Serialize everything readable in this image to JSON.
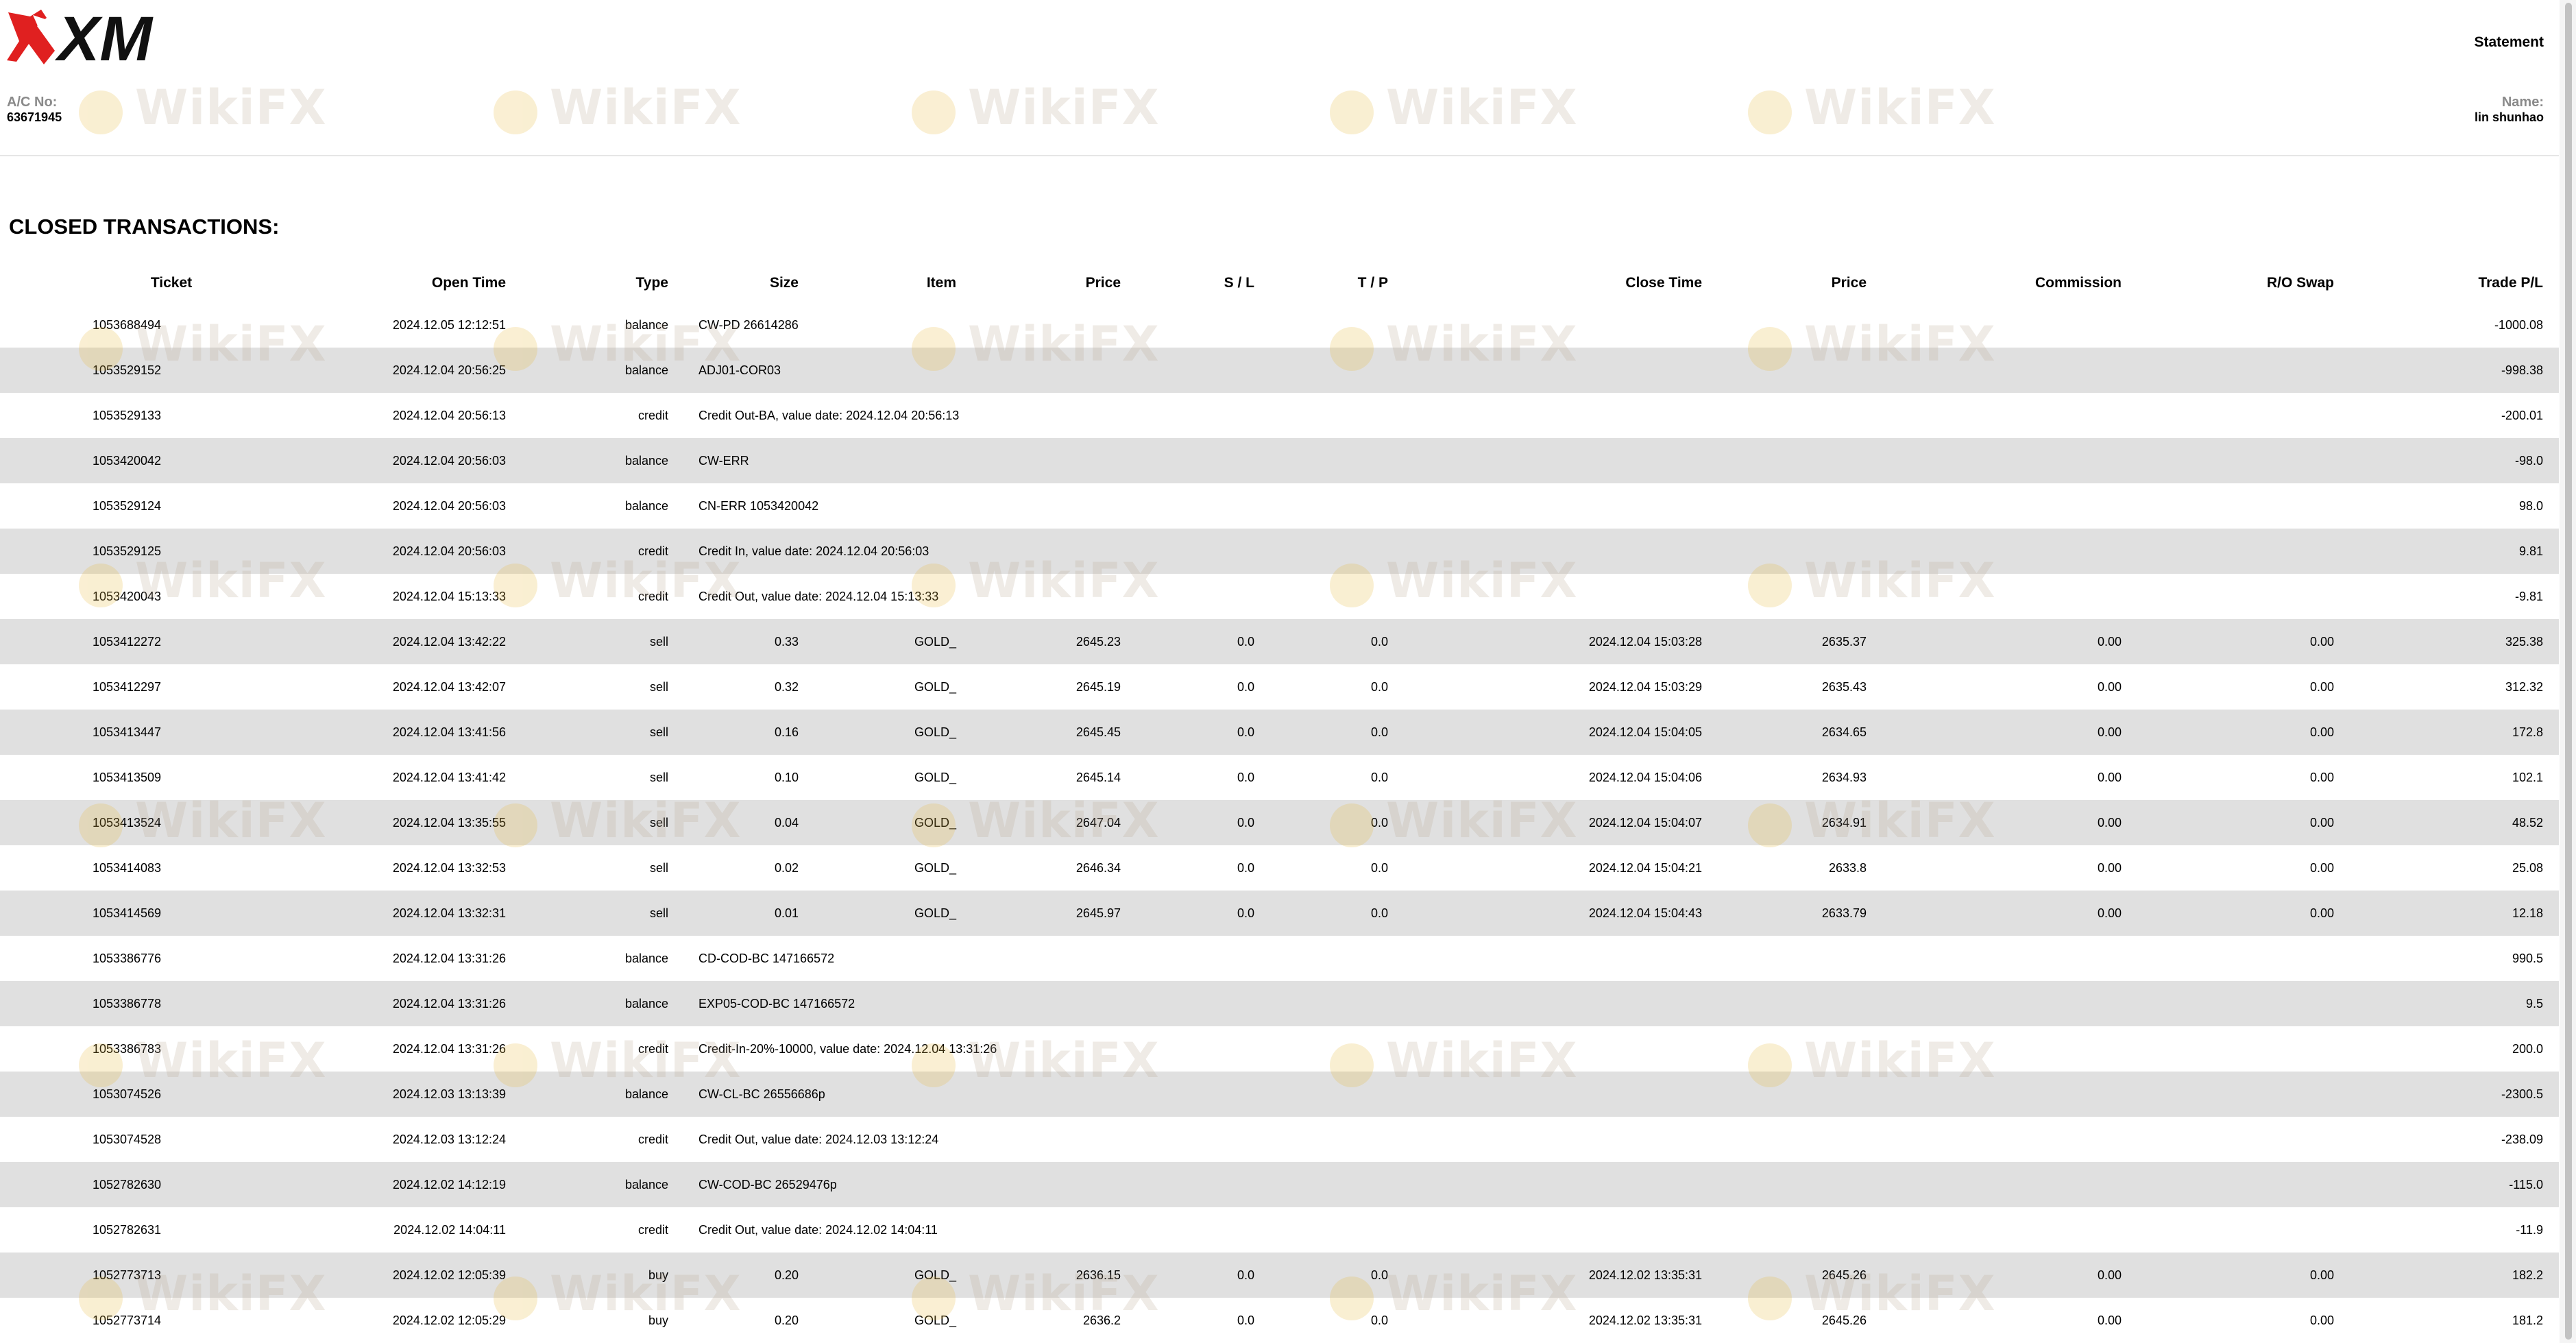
{
  "header": {
    "logo_text": "XM",
    "title": "Statement",
    "account_label": "A/C No:",
    "account_value": "63671945",
    "name_label": "Name:",
    "name_value": "lin shunhao"
  },
  "watermark": "WikiFX",
  "colors": {
    "logo_red": "#e02020",
    "logo_black": "#111111",
    "alt_row_bg": "#e0e0e0",
    "watermark_gold": "#e8b838"
  },
  "section_title": "CLOSED TRANSACTIONS:",
  "columns": [
    "Ticket",
    "Open Time",
    "Type",
    "Size",
    "Item",
    "Price",
    "S / L",
    "T / P",
    "Close Time",
    "Price",
    "Commission",
    "R/O Swap",
    "Trade P/L"
  ],
  "rows": [
    {
      "ticket": "1053688494",
      "open": "2024.12.05 12:12:51",
      "type": "balance",
      "desc": "CW-PD 26614286",
      "pl": "-1000.08"
    },
    {
      "ticket": "1053529152",
      "open": "2024.12.04 20:56:25",
      "type": "balance",
      "desc": "ADJ01-COR03",
      "pl": "-998.38"
    },
    {
      "ticket": "1053529133",
      "open": "2024.12.04 20:56:13",
      "type": "credit",
      "desc": "Credit Out-BA, value date: 2024.12.04 20:56:13",
      "pl": "-200.01"
    },
    {
      "ticket": "1053420042",
      "open": "2024.12.04 20:56:03",
      "type": "balance",
      "desc": "CW-ERR",
      "pl": "-98.0"
    },
    {
      "ticket": "1053529124",
      "open": "2024.12.04 20:56:03",
      "type": "balance",
      "desc": "CN-ERR 1053420042",
      "pl": "98.0"
    },
    {
      "ticket": "1053529125",
      "open": "2024.12.04 20:56:03",
      "type": "credit",
      "desc": "Credit In, value date: 2024.12.04 20:56:03",
      "pl": "9.81"
    },
    {
      "ticket": "1053420043",
      "open": "2024.12.04 15:13:33",
      "type": "credit",
      "desc": "Credit Out, value date: 2024.12.04 15:13:33",
      "pl": "-9.81"
    },
    {
      "ticket": "1053412272",
      "open": "2024.12.04 13:42:22",
      "type": "sell",
      "size": "0.33",
      "item": "GOLD_",
      "price": "2645.23",
      "sl": "0.0",
      "tp": "0.0",
      "close": "2024.12.04 15:03:28",
      "cprice": "2635.37",
      "comm": "0.00",
      "swap": "0.00",
      "pl": "325.38"
    },
    {
      "ticket": "1053412297",
      "open": "2024.12.04 13:42:07",
      "type": "sell",
      "size": "0.32",
      "item": "GOLD_",
      "price": "2645.19",
      "sl": "0.0",
      "tp": "0.0",
      "close": "2024.12.04 15:03:29",
      "cprice": "2635.43",
      "comm": "0.00",
      "swap": "0.00",
      "pl": "312.32"
    },
    {
      "ticket": "1053413447",
      "open": "2024.12.04 13:41:56",
      "type": "sell",
      "size": "0.16",
      "item": "GOLD_",
      "price": "2645.45",
      "sl": "0.0",
      "tp": "0.0",
      "close": "2024.12.04 15:04:05",
      "cprice": "2634.65",
      "comm": "0.00",
      "swap": "0.00",
      "pl": "172.8"
    },
    {
      "ticket": "1053413509",
      "open": "2024.12.04 13:41:42",
      "type": "sell",
      "size": "0.10",
      "item": "GOLD_",
      "price": "2645.14",
      "sl": "0.0",
      "tp": "0.0",
      "close": "2024.12.04 15:04:06",
      "cprice": "2634.93",
      "comm": "0.00",
      "swap": "0.00",
      "pl": "102.1"
    },
    {
      "ticket": "1053413524",
      "open": "2024.12.04 13:35:55",
      "type": "sell",
      "size": "0.04",
      "item": "GOLD_",
      "price": "2647.04",
      "sl": "0.0",
      "tp": "0.0",
      "close": "2024.12.04 15:04:07",
      "cprice": "2634.91",
      "comm": "0.00",
      "swap": "0.00",
      "pl": "48.52"
    },
    {
      "ticket": "1053414083",
      "open": "2024.12.04 13:32:53",
      "type": "sell",
      "size": "0.02",
      "item": "GOLD_",
      "price": "2646.34",
      "sl": "0.0",
      "tp": "0.0",
      "close": "2024.12.04 15:04:21",
      "cprice": "2633.8",
      "comm": "0.00",
      "swap": "0.00",
      "pl": "25.08"
    },
    {
      "ticket": "1053414569",
      "open": "2024.12.04 13:32:31",
      "type": "sell",
      "size": "0.01",
      "item": "GOLD_",
      "price": "2645.97",
      "sl": "0.0",
      "tp": "0.0",
      "close": "2024.12.04 15:04:43",
      "cprice": "2633.79",
      "comm": "0.00",
      "swap": "0.00",
      "pl": "12.18"
    },
    {
      "ticket": "1053386776",
      "open": "2024.12.04 13:31:26",
      "type": "balance",
      "desc": "CD-COD-BC 147166572",
      "pl": "990.5"
    },
    {
      "ticket": "1053386778",
      "open": "2024.12.04 13:31:26",
      "type": "balance",
      "desc": "EXP05-COD-BC 147166572",
      "pl": "9.5"
    },
    {
      "ticket": "1053386783",
      "open": "2024.12.04 13:31:26",
      "type": "credit",
      "desc": "Credit-In-20%-10000, value date: 2024.12.04 13:31:26",
      "pl": "200.0"
    },
    {
      "ticket": "1053074526",
      "open": "2024.12.03 13:13:39",
      "type": "balance",
      "desc": "CW-CL-BC 26556686p",
      "pl": "-2300.5"
    },
    {
      "ticket": "1053074528",
      "open": "2024.12.03 13:12:24",
      "type": "credit",
      "desc": "Credit Out, value date: 2024.12.03 13:12:24",
      "pl": "-238.09"
    },
    {
      "ticket": "1052782630",
      "open": "2024.12.02 14:12:19",
      "type": "balance",
      "desc": "CW-COD-BC 26529476p",
      "pl": "-115.0"
    },
    {
      "ticket": "1052782631",
      "open": "2024.12.02 14:04:11",
      "type": "credit",
      "desc": "Credit Out, value date: 2024.12.02 14:04:11",
      "pl": "-11.9"
    },
    {
      "ticket": "1052773713",
      "open": "2024.12.02 12:05:39",
      "type": "buy",
      "size": "0.20",
      "item": "GOLD_",
      "price": "2636.15",
      "sl": "0.0",
      "tp": "0.0",
      "close": "2024.12.02 13:35:31",
      "cprice": "2645.26",
      "comm": "0.00",
      "swap": "0.00",
      "pl": "182.2"
    },
    {
      "ticket": "1052773714",
      "open": "2024.12.02 12:05:29",
      "type": "buy",
      "size": "0.20",
      "item": "GOLD_",
      "price": "2636.2",
      "sl": "0.0",
      "tp": "0.0",
      "close": "2024.12.02 13:35:31",
      "cprice": "2645.26",
      "comm": "0.00",
      "swap": "0.00",
      "pl": "181.2"
    }
  ]
}
